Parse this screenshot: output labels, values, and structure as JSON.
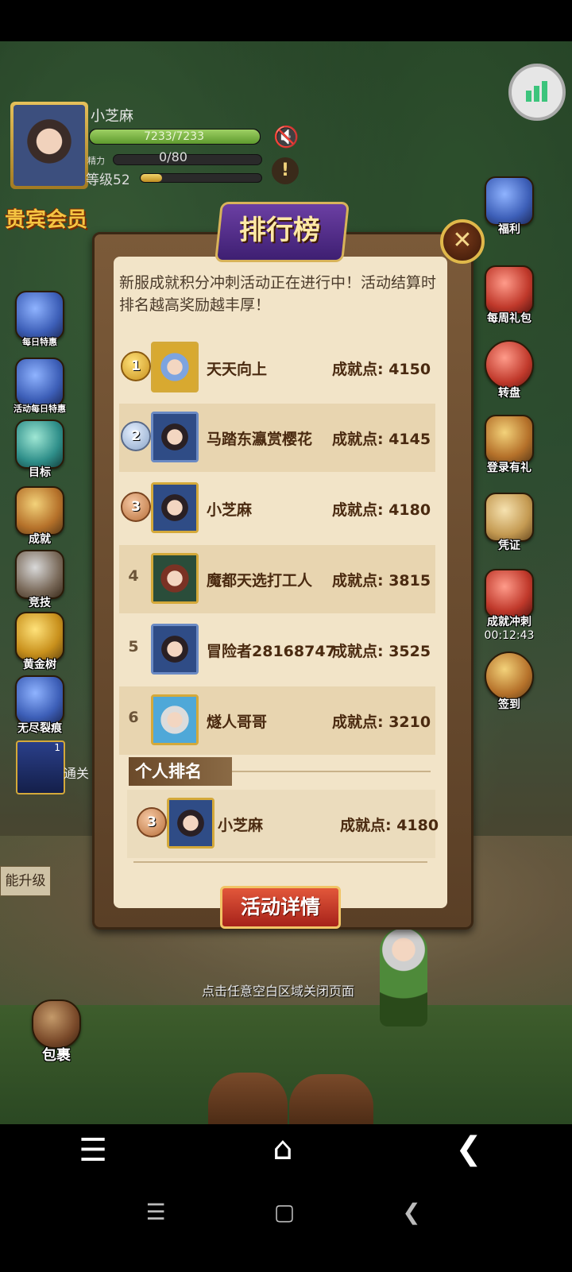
{
  "player": {
    "name": "小芝麻",
    "hp_text": "7233/7233",
    "energy_label": "精力",
    "energy_text": "0/80",
    "level_text": "等级52",
    "vip_label": "贵宾会员"
  },
  "left_menu": [
    {
      "icon": "chest-icon",
      "label": "每日特惠"
    },
    {
      "icon": "chest-icon",
      "label": "活动每日特惠"
    },
    {
      "icon": "potion-icon",
      "label": "目标"
    },
    {
      "icon": "laurel-icon",
      "label": "成就"
    },
    {
      "icon": "swords-icon",
      "label": "竞技"
    },
    {
      "icon": "gold-tree-icon",
      "label": "黄金树"
    },
    {
      "icon": "rift-icon",
      "label": "无尽裂痕"
    }
  ],
  "left_extras": {
    "item_badge": "1",
    "pass_label": "通关",
    "upgrade_label": "能升级"
  },
  "right_menu": [
    {
      "icon": "treasure-chest-icon",
      "label": "福利"
    },
    {
      "icon": "gift-box-icon",
      "label": "每周礼包"
    },
    {
      "icon": "wheel-icon",
      "label": "转盘"
    },
    {
      "icon": "gift-icon",
      "label": "登录有礼"
    },
    {
      "icon": "scroll-icon",
      "label": "凭证"
    },
    {
      "icon": "banner-icon",
      "label": "成就冲刺",
      "timer": "00:12:43"
    },
    {
      "icon": "checkin-icon",
      "label": "签到"
    }
  ],
  "bag_label": "包裹",
  "leaderboard": {
    "title": "排行榜",
    "intro": "新服成就积分冲刺活动正在进行中！活动结算时排名越高奖励越丰厚！",
    "rows": [
      {
        "rank": "1",
        "name": "天天向上",
        "score": "成就点: 4150"
      },
      {
        "rank": "2",
        "name": "马踏东瀛赏樱花",
        "score": "成就点: 4145"
      },
      {
        "rank": "3",
        "name": "小芝麻",
        "score": "成就点: 4180"
      },
      {
        "rank": "4",
        "name": "魔都天选打工人",
        "score": "成就点: 3815"
      },
      {
        "rank": "5",
        "name": "冒险者28168747",
        "score": "成就点: 3525"
      },
      {
        "rank": "6",
        "name": "燧人哥哥",
        "score": "成就点: 3210"
      }
    ],
    "personal_section": "个人排名",
    "personal": {
      "rank": "3",
      "name": "小芝麻",
      "score": "成就点: 4180"
    },
    "detail_button": "活动详情",
    "close_hint": "点击任意空白区域关闭页面"
  },
  "colors": {
    "panel_bg": "#f2e4c8",
    "title_purple": "#4a2a85",
    "button_red": "#c0392b",
    "hp_green": "#7fb446"
  }
}
